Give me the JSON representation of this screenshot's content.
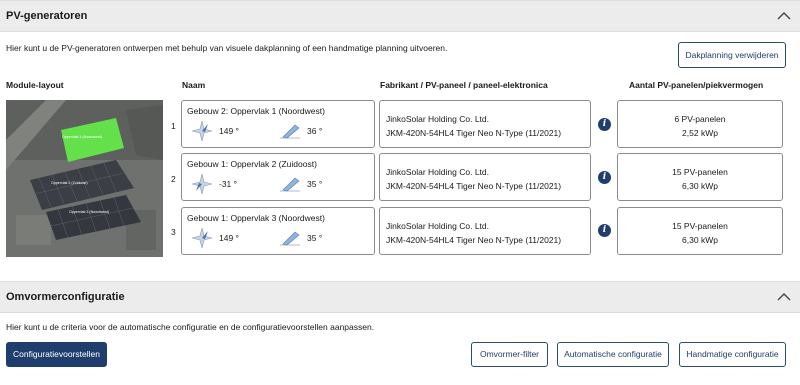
{
  "pv": {
    "title": "PV-generatoren",
    "intro": "Hier kunt u de PV-generatoren ontwerpen met behulp van visuele dakplanning of een handmatige planning uitvoeren.",
    "delete_button": "Dakplanning verwijderen",
    "columns": {
      "layout": "Module-layout",
      "name": "Naam",
      "manufacturer": "Fabrikant / PV-paneel / paneel-elektronica",
      "count": "Aantal PV-panelen/piekvermogen"
    },
    "roof_labels": [
      "Oppervlak 1 (Noordwest)",
      "Oppervlak 2 (Zuidoost)",
      "Oppervlak 3 (Noordwest)"
    ],
    "rows": [
      {
        "num": "1",
        "name": "Gebouw 2: Oppervlak 1 (Noordwest)",
        "orientation": "149 °",
        "tilt": "36 °",
        "manufacturer": "JinkoSolar Holding Co. Ltd.",
        "panel": "JKM-420N-54HL4 Tiger Neo N-Type (11/2021)",
        "panels": "6 PV-panelen",
        "power": "2,52 kWp"
      },
      {
        "num": "2",
        "name": "Gebouw 1: Oppervlak 2 (Zuidoost)",
        "orientation": "-31 °",
        "tilt": "35 °",
        "manufacturer": "JinkoSolar Holding Co. Ltd.",
        "panel": "JKM-420N-54HL4 Tiger Neo N-Type (11/2021)",
        "panels": "15 PV-panelen",
        "power": "6,30 kWp"
      },
      {
        "num": "3",
        "name": "Gebouw 1: Oppervlak 3 (Noordwest)",
        "orientation": "149 °",
        "tilt": "35 °",
        "manufacturer": "JinkoSolar Holding Co. Ltd.",
        "panel": "JKM-420N-54HL4 Tiger Neo N-Type (11/2021)",
        "panels": "15 PV-panelen",
        "power": "6,30 kWp"
      }
    ]
  },
  "inverter": {
    "title": "Omvormerconfiguratie",
    "intro": "Hier kunt u de criteria voor de automatische configuratie en de configuratievoorstellen aanpassen.",
    "proposals_button": "Configuratievoorstellen",
    "filter_button": "Omvormer-filter",
    "auto_button": "Automatische configuratie",
    "manual_button": "Handmatige configuratie"
  },
  "icons": {
    "collapse": "chevron-up-icon",
    "info": "info-icon",
    "orientation": "compass-orientation-icon",
    "tilt": "panel-tilt-icon"
  },
  "colors": {
    "primary": "#1f3d6d",
    "header_bg": "#ececec",
    "highlight_roof": "#63e04a"
  }
}
